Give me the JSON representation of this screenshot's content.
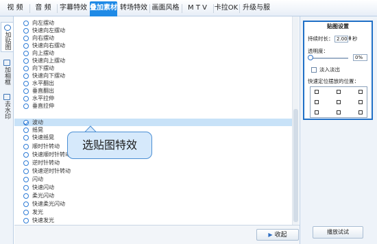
{
  "tabs": [
    {
      "label": "视  频",
      "active": false
    },
    {
      "label": "音  频",
      "active": false
    },
    {
      "label": "字幕特效",
      "active": false
    },
    {
      "label": "叠加素材",
      "active": true
    },
    {
      "label": "转场特效",
      "active": false
    },
    {
      "label": "画面风格",
      "active": false
    },
    {
      "label": "M T V",
      "active": false
    },
    {
      "label": "卡拉OK",
      "active": false
    },
    {
      "label": "升级与服务",
      "active": false
    }
  ],
  "side_tabs": [
    {
      "label": "加贴图",
      "icon": "sticker-icon",
      "active": true
    },
    {
      "label": "加相框",
      "icon": "frame-icon",
      "active": false
    },
    {
      "label": "去水印",
      "icon": "watermark-icon",
      "active": false
    }
  ],
  "effects": [
    "向左摆动",
    "快速向左摆动",
    "向右摆动",
    "快速向右摆动",
    "向上摆动",
    "快速向上摆动",
    "向下摆动",
    "快速向下摆动",
    "水平翻出",
    "垂直翻出",
    "水平拉伸",
    "垂直拉伸",
    "波动",
    "摇晃",
    "快速摇晃",
    "顺时针转动",
    "快速顺时针转动",
    "逆时针转动",
    "快速逆时针转动",
    "闪动",
    "快速闪动",
    "柔光闪动",
    "快速柔光闪动",
    "发光",
    "快速发光"
  ],
  "selected_effect": "波动",
  "callout": {
    "text": "选贴图特效"
  },
  "bottom": {
    "collapse_label": "收起"
  },
  "settings": {
    "title": "贴图设置",
    "duration_label": "持续时长：",
    "duration_value": "2.00",
    "duration_unit": "秒",
    "opacity_label": "透明度：",
    "opacity_value": "0%",
    "opacity_fraction": 0.0,
    "fade_label": "淡入淡出",
    "fade_checked": false,
    "position_label": "快速定位摆放的位置："
  },
  "preview": {
    "label": "播放试试"
  },
  "colors": {
    "accent": "#1f8ae6",
    "selection": "#c8e2f8",
    "panel_border": "#1f6fc6",
    "callout_bg": "#d6e9fb"
  }
}
